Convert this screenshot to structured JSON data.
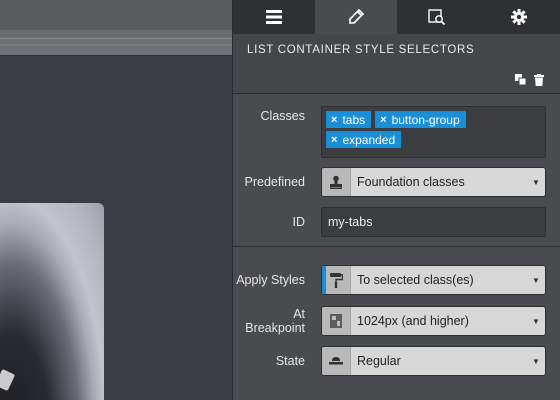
{
  "tabs": [
    {
      "name": "list-icon"
    },
    {
      "name": "brush-icon"
    },
    {
      "name": "inspect-icon"
    },
    {
      "name": "gear-icon"
    }
  ],
  "panel": {
    "title": "LIST CONTAINER STYLE SELECTORS"
  },
  "classes": {
    "label": "Classes",
    "chips": [
      "tabs",
      "button-group",
      "expanded"
    ],
    "remove_glyph": "×"
  },
  "predefined": {
    "label": "Predefined",
    "value": "Foundation classes"
  },
  "id_field": {
    "label": "ID",
    "value": "my-tabs"
  },
  "apply_styles": {
    "label": "Apply Styles",
    "value": "To selected class(es)"
  },
  "breakpoint": {
    "label": "At Breakpoint",
    "value": "1024px (and higher)"
  },
  "state": {
    "label": "State",
    "value": "Regular"
  },
  "colors": {
    "accent": "#1a8fd8",
    "panel_bg": "#4a4b4f",
    "tabbar_bg": "#2f3033"
  }
}
